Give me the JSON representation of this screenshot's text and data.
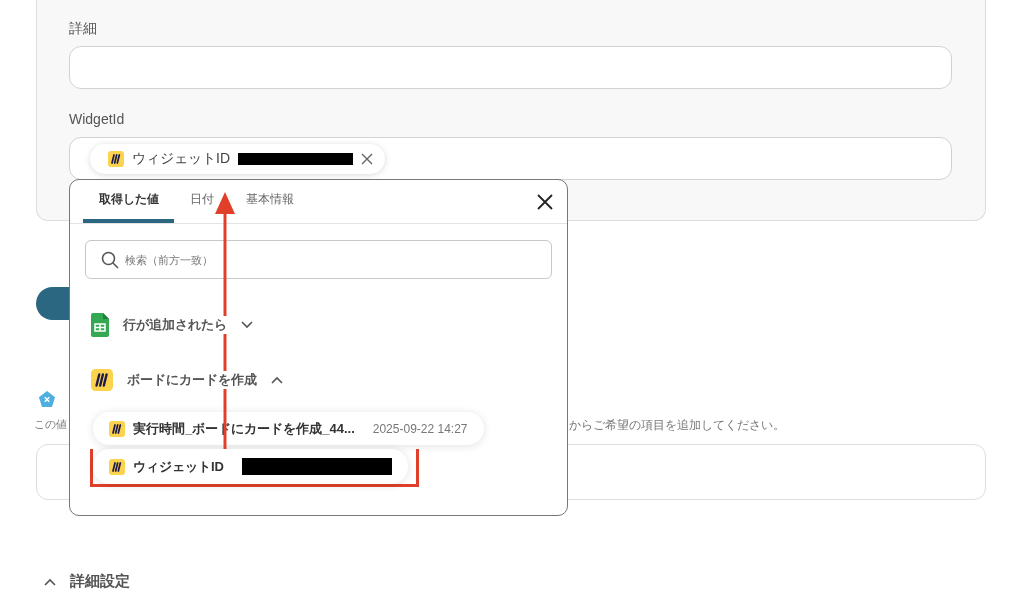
{
  "form": {
    "fields": [
      {
        "label": "詳細",
        "kind": "text"
      },
      {
        "label": "WidgetId",
        "kind": "chips",
        "chips": [
          {
            "label": "ウィジェットID",
            "redacted": true
          }
        ]
      }
    ]
  },
  "popup": {
    "tabs": [
      {
        "label": "取得した値",
        "selected": true
      },
      {
        "label": "日付",
        "selected": false
      },
      {
        "label": "基本情報",
        "selected": false
      }
    ],
    "search": {
      "placeholder": "検索（前方一致）"
    },
    "groups": [
      {
        "kind": "sheets",
        "title": "行が追加されたら",
        "expanded": false
      },
      {
        "kind": "miro",
        "title": "ボードにカードを作成",
        "expanded": true,
        "items": [
          {
            "label": "実行時間_ボードにカードを作成_44...",
            "value": "2025-09-22 14:27",
            "redacted": false,
            "highlighted": false
          },
          {
            "label": "ウィジェットID",
            "redacted": true,
            "highlighted": true
          }
        ]
      }
    ]
  },
  "section": {
    "caption_start": "この値",
    "caption_end": "からご希望の項目を追加してください。"
  },
  "advanced": {
    "title": "詳細設定",
    "expanded": true
  }
}
